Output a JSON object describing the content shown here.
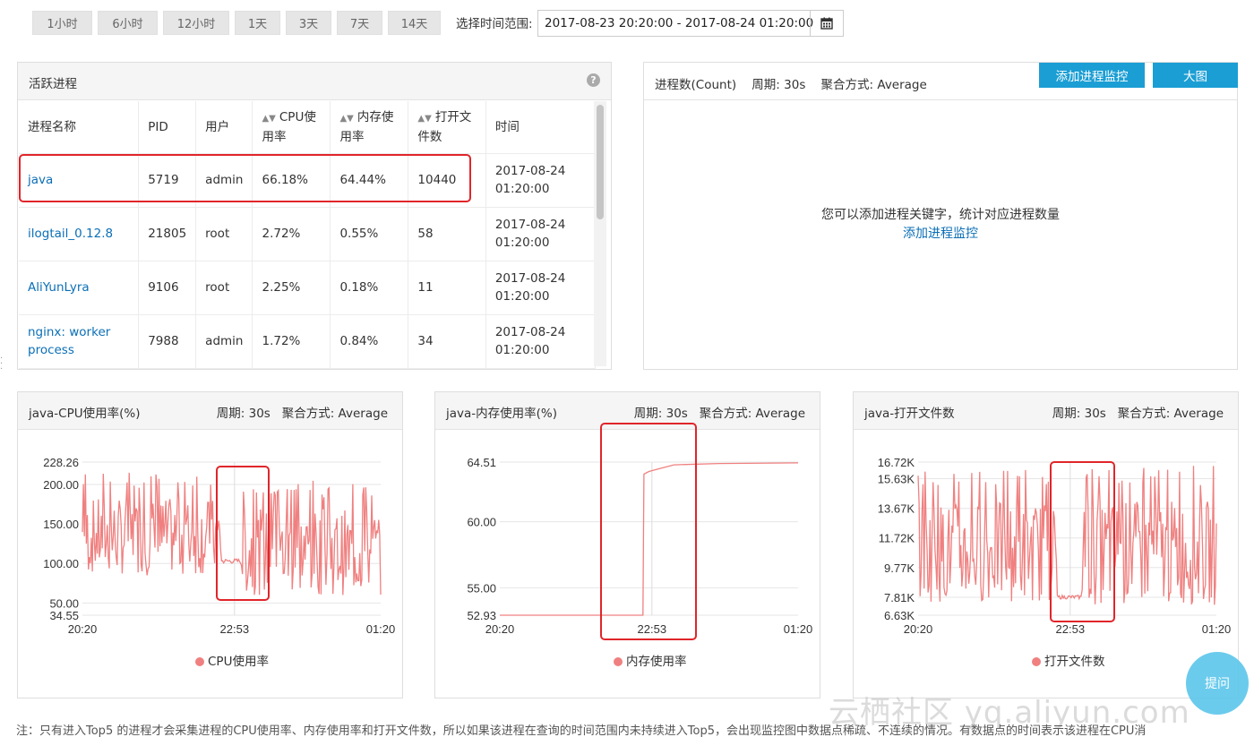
{
  "time_buttons": [
    "1小时",
    "6小时",
    "12小时",
    "1天",
    "3天",
    "7天",
    "14天"
  ],
  "range": {
    "label": "选择时间范围:",
    "value": "2017-08-23 20:20:00 - 2017-08-24 01:20:00",
    "icon": "calendar-icon"
  },
  "process_panel": {
    "title": "活跃进程",
    "help_icon": "?",
    "columns": [
      {
        "label_line1": "进程名称",
        "label_line2": "",
        "sortable": false
      },
      {
        "label_line1": "PID",
        "label_line2": "",
        "sortable": false
      },
      {
        "label_line1": "用户",
        "label_line2": "",
        "sortable": false
      },
      {
        "label_line1": "CPU使",
        "label_line2": "用率",
        "sortable": true
      },
      {
        "label_line1": "内存使",
        "label_line2": "用率",
        "sortable": true
      },
      {
        "label_line1": "打开文",
        "label_line2": "件数",
        "sortable": true
      },
      {
        "label_line1": "时间",
        "label_line2": "",
        "sortable": false
      }
    ],
    "rows": [
      {
        "name": "java",
        "pid": "5719",
        "user": "admin",
        "cpu": "66.18%",
        "mem": "64.44%",
        "files": "10440",
        "date": "2017-08-24",
        "time": "01:20:00"
      },
      {
        "name": "ilogtail_0.12.8",
        "pid": "21805",
        "user": "root",
        "cpu": "2.72%",
        "mem": "0.55%",
        "files": "58",
        "date": "2017-08-24",
        "time": "01:20:00"
      },
      {
        "name": "AliYunLyra",
        "pid": "9106",
        "user": "root",
        "cpu": "2.25%",
        "mem": "0.18%",
        "files": "11",
        "date": "2017-08-24",
        "time": "01:20:00"
      },
      {
        "name": "nginx: worker process",
        "pid": "7988",
        "user": "admin",
        "cpu": "1.72%",
        "mem": "0.84%",
        "files": "34",
        "date": "2017-08-24",
        "time": "01:20:00"
      }
    ]
  },
  "count_panel": {
    "title": "进程数(Count)",
    "period": "周期: 30s",
    "agg": "聚合方式: Average",
    "add_button": "添加进程监控",
    "big_button": "大图",
    "empty_message": "您可以添加进程关键字，统计对应进程数量",
    "empty_link": "添加进程监控"
  },
  "chart_data": [
    {
      "type": "line",
      "title": "java-CPU使用率(%)",
      "period": "周期: 30s",
      "agg": "聚合方式: Average",
      "legend": "CPU使用率",
      "legend_placement": "bottom",
      "ytick_labels": [
        "228.26",
        "200.00",
        "150.00",
        "100.00",
        "50.00",
        "34.55"
      ],
      "yticks": [
        228.26,
        200,
        150,
        100,
        50,
        34.55
      ],
      "ylim": [
        34.55,
        228.26
      ],
      "xtick_labels": [
        "20:20",
        "22:53",
        "01:20"
      ],
      "x_start": "20:20",
      "x_end": "01:20",
      "series_color": "#f08080",
      "profile": {
        "noisy_1": [
          85,
          215
        ],
        "quiet": [
          100,
          112
        ],
        "noisy_2": [
          60,
          205
        ]
      },
      "quiet_window": [
        "22:40",
        "23:00"
      ]
    },
    {
      "type": "line",
      "title": "java-内存使用率(%)",
      "period": "周期: 30s",
      "agg": "聚合方式: Average",
      "legend": "内存使用率",
      "legend_placement": "bottom",
      "ytick_labels": [
        "64.51",
        "60.00",
        "55.00",
        "52.93"
      ],
      "yticks": [
        64.51,
        60,
        55,
        52.93
      ],
      "ylim": [
        52.93,
        64.51
      ],
      "xtick_labels": [
        "20:20",
        "22:53",
        "01:20"
      ],
      "x_start": "20:20",
      "x_end": "01:20",
      "series_color": "#f08080",
      "points": [
        [
          "20:20",
          52.93
        ],
        [
          "22:44",
          52.93
        ],
        [
          "22:45",
          63.6
        ],
        [
          "22:50",
          63.8
        ],
        [
          "23:00",
          64.0
        ],
        [
          "23:15",
          64.3
        ],
        [
          "00:00",
          64.4
        ],
        [
          "01:20",
          64.45
        ]
      ]
    },
    {
      "type": "line",
      "title": "java-打开文件数",
      "period": "周期: 30s",
      "agg": "聚合方式: Average",
      "legend": "打开文件数",
      "legend_placement": "bottom",
      "ytick_labels": [
        "16.72K",
        "15.63K",
        "13.67K",
        "11.72K",
        "9.77K",
        "7.81K",
        "6.63K"
      ],
      "yticks": [
        16720,
        15630,
        13670,
        11720,
        9770,
        7810,
        6630
      ],
      "ylim": [
        6630,
        16720
      ],
      "xtick_labels": [
        "20:20",
        "22:53",
        "01:20"
      ],
      "x_start": "20:20",
      "x_end": "01:20",
      "series_color": "#f08080",
      "profile": {
        "noisy_1": [
          7500,
          16300
        ],
        "quiet": [
          7700,
          8200
        ],
        "noisy_2": [
          7300,
          16500
        ]
      },
      "quiet_window": [
        "22:40",
        "23:05"
      ]
    }
  ],
  "note": "注：只有进入Top5 的进程才会采集进程的CPU使用率、内存使用率和打开文件数，所以如果该进程在查询的时间范围内未持续进入Top5，会出现监控图中数据点稀疏、不连续的情况。有数据点的时间表示该进程在CPU消",
  "ask_button": "提问",
  "watermark": "云栖社区 yq.aliyun.com"
}
